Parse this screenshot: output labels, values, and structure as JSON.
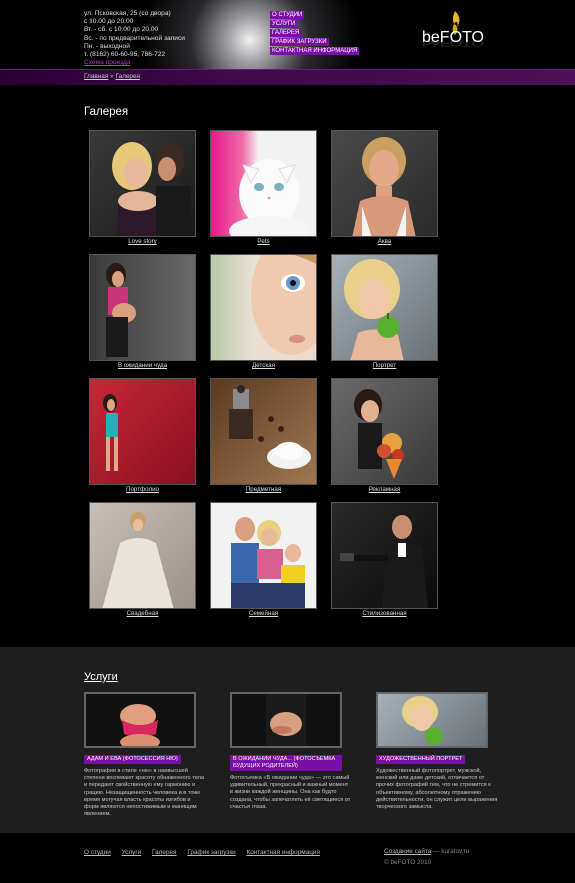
{
  "header": {
    "contacts": [
      "ул. Псковская, 25 (со двора)",
      "с 10.00 до 20.00",
      "Вт. - сб. с 10.00 до 20.00",
      "Вс. - по предварительной записи",
      "Пн. - выходной",
      "т. (8162) 60-60-95, 786-722"
    ],
    "map_link": "Схема проезда",
    "nav": [
      "О СТУДИИ",
      "УСЛУГИ",
      "ГАЛЕРЕЯ",
      "ГРАФИК ЗАГРУЗКИ",
      "КОНТАКТНАЯ ИНФОРМАЦИЯ"
    ],
    "logo": {
      "be": "be",
      "foto": "FOTO"
    }
  },
  "breadcrumb": {
    "home": "Главная",
    "sep": "»",
    "current": "Галерея"
  },
  "page_title": "Галерея",
  "gallery": [
    "Love story",
    "Pets",
    "Аква",
    "В ожидании чуда",
    "Детская",
    "Портрет",
    "Портфолио",
    "Предметная",
    "Рекламная",
    "Свадебная",
    "Семейная",
    "Стилизованная"
  ],
  "services": {
    "title": "Услуги",
    "cards": [
      {
        "badge": "АДАМ И ЕВА (ФОТОСЕССИЯ НЮ)",
        "text": "Фотографии в стиле «ню» в наивысшей степени воспевают красоту обнаженного тела и передают свойственную ему гармонию и грацию. Незащищенность человека и в тоже время могучая власть красоты изгибов и форм являются непостижимым и манящим явлением."
      },
      {
        "badge": "В ОЖИДАНИИ ЧУДА... (ФОТОСЪЕМКА БУДУЩИХ РОДИТЕЛЕЙ)",
        "text": "Фотосъемка «В ожидании чуда» — это самый удивительный, прекрасный и важный момент в жизни каждой женщины. Она как будто создана, чтобы запечатлеть её светящиеся от счастья глаза."
      },
      {
        "badge": "ХУДОЖЕСТВЕННЫЙ ПОРТРЕТ",
        "text": "Художественный фотопортрет, мужской, женский или даже детский, отличается от прочих фотографий тем, что не стремится к объективному, абсолютному отражению действительности, он служит цели выражения творческого замысла."
      }
    ]
  },
  "footer": {
    "nav": [
      "О студии",
      "Услуги",
      "Галерея",
      "График загрузки",
      "Контактная информация"
    ],
    "site_link": "Создание сайта",
    "site_by": " — kuratov.ru",
    "copyright": "© beFOTO 2010"
  },
  "colors": {
    "accent": "#7a0ea8",
    "bar": "#3d0a4a",
    "services_bg": "#1e1e1e"
  }
}
